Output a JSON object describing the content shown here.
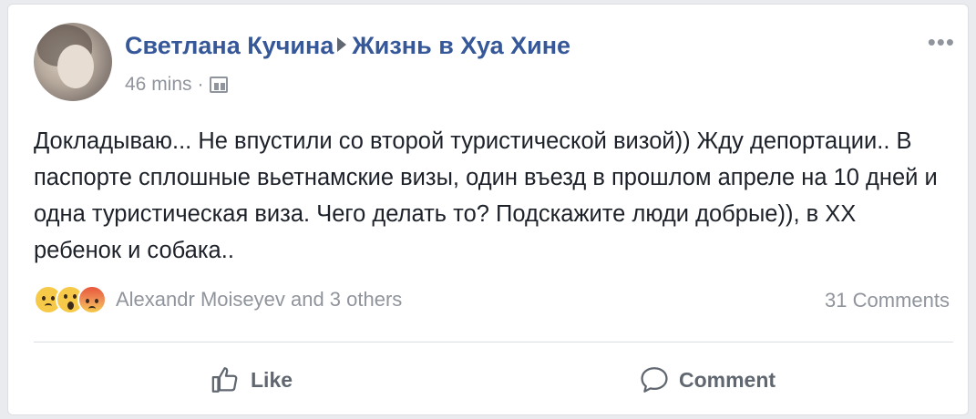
{
  "post": {
    "author": "Светлана Кучина",
    "group": "Жизнь в Хуа Хине",
    "timestamp": "46 mins",
    "separator": "·",
    "audience_icon": "group-icon",
    "more_label": "•••",
    "text": "Докладываю... Не впустили со второй туристической визой)) Жду депортации.. В паспорте сплошные вьетнамские визы, один въезд в прошлом апреле на 10 дней и одна туристическая виза. Чего делать то? Подскажите люди добрые)), в ХХ ребенок и собака.."
  },
  "reactions": {
    "icons": [
      "sad-emoji",
      "wow-emoji",
      "angry-emoji"
    ],
    "summary": "Alexandr Moiseyev and 3 others",
    "comments": "31 Comments"
  },
  "actions": {
    "like": "Like",
    "comment": "Comment"
  },
  "colors": {
    "link": "#365899",
    "muted": "#90949c",
    "text": "#1d2129",
    "background": "#e9ebee"
  }
}
